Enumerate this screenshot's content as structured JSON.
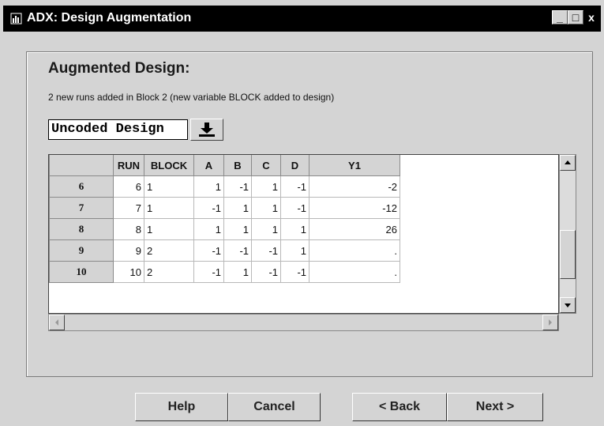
{
  "window": {
    "title": "ADX: Design Augmentation",
    "controls": {
      "minimize": "_",
      "maximize": "□",
      "close": "x"
    }
  },
  "panel": {
    "heading": "Augmented Design:",
    "subtitle": "2 new runs added in Block 2 (new variable BLOCK added to design)"
  },
  "design_select": {
    "value": "Uncoded Design",
    "download_icon": "download-arrow-icon"
  },
  "grid": {
    "columns": [
      "",
      "RUN",
      "BLOCK",
      "A",
      "B",
      "C",
      "D",
      "Y1"
    ],
    "rows": [
      {
        "row": "6",
        "run": "6",
        "block": "1",
        "a": "1",
        "b": "-1",
        "c": "1",
        "d": "-1",
        "y1": "-2"
      },
      {
        "row": "7",
        "run": "7",
        "block": "1",
        "a": "-1",
        "b": "1",
        "c": "1",
        "d": "-1",
        "y1": "-12"
      },
      {
        "row": "8",
        "run": "8",
        "block": "1",
        "a": "1",
        "b": "1",
        "c": "1",
        "d": "1",
        "y1": "26"
      },
      {
        "row": "9",
        "run": "9",
        "block": "2",
        "a": "-1",
        "b": "-1",
        "c": "-1",
        "d": "1",
        "y1": "."
      },
      {
        "row": "10",
        "run": "10",
        "block": "2",
        "a": "-1",
        "b": "1",
        "c": "-1",
        "d": "-1",
        "y1": "."
      }
    ]
  },
  "buttons": {
    "help": "Help",
    "cancel": "Cancel",
    "back": "< Back",
    "next": "Next >"
  }
}
